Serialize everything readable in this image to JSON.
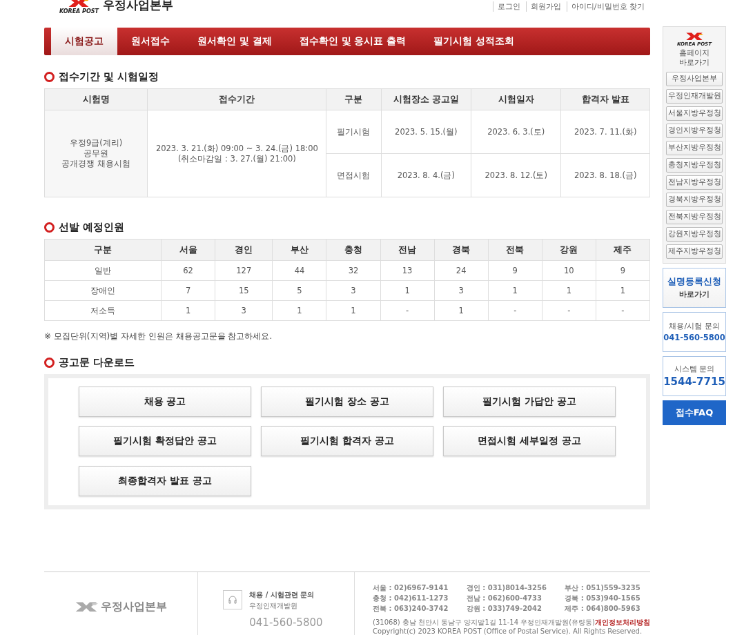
{
  "header": {
    "logo_text": "우정사업본부",
    "logo_caption": "KOREA POST",
    "top_links": [
      "로그인",
      "회원가입",
      "아이디/비밀번호 찾기"
    ]
  },
  "nav": [
    {
      "label": "시험공고",
      "selected": true
    },
    {
      "label": "원서접수",
      "selected": false
    },
    {
      "label": "원서확인 및 결제",
      "selected": false
    },
    {
      "label": "접수확인 및 응시표 출력",
      "selected": false
    },
    {
      "label": "필기시험 성적조회",
      "selected": false
    }
  ],
  "schedule": {
    "title": "접수기간 및 시험일정",
    "columns": [
      "시험명",
      "접수기간",
      "구분",
      "시험장소 공고일",
      "시험일자",
      "합격자 발표"
    ],
    "exam_name": [
      "우정9급(계리)",
      "공무원",
      "공개경쟁 채용시험"
    ],
    "period": [
      "2023. 3. 21.(화) 09:00 ~ 3. 24.(금) 18:00",
      "(취소마감일 : 3. 27.(월) 21:00)"
    ],
    "rows": [
      {
        "type": "필기시험",
        "dates": [
          "2023. 5. 15.(월)",
          "2023. 6. 3.(토)",
          "2023. 7. 11.(화)"
        ]
      },
      {
        "type": "면접시험",
        "dates": [
          "2023. 8. 4.(금)",
          "2023. 8. 12.(토)",
          "2023. 8. 18.(금)"
        ]
      }
    ]
  },
  "quota": {
    "title": "선발 예정인원",
    "columns": [
      "구분",
      "서울",
      "경인",
      "부산",
      "충청",
      "전남",
      "경북",
      "전북",
      "강원",
      "제주"
    ],
    "rows": [
      {
        "label": "일반",
        "values": [
          "62",
          "127",
          "44",
          "32",
          "13",
          "24",
          "9",
          "10",
          "9"
        ]
      },
      {
        "label": "장애인",
        "values": [
          "7",
          "15",
          "5",
          "3",
          "1",
          "3",
          "1",
          "1",
          "1"
        ]
      },
      {
        "label": "저소득",
        "values": [
          "1",
          "3",
          "1",
          "1",
          "-",
          "1",
          "-",
          "-",
          "-"
        ]
      }
    ],
    "note": "※ 모집단위(지역)별 자세한 인원은 채용공고문을 참고하세요."
  },
  "downloads": {
    "title": "공고문 다운로드",
    "buttons": [
      "채용 공고",
      "필기시험 장소 공고",
      "필기시험 가답안 공고",
      "필기시험 확정답안 공고",
      "필기시험 합격자 공고",
      "면접시험 세부일정 공고",
      "최종합격자 발표 공고"
    ]
  },
  "sidebar": {
    "logo_caption": "KOREA POST",
    "homepage_label": [
      "홈페이지",
      "바로가기"
    ],
    "links": [
      "우정사업본부",
      "우정인재개발원",
      "서울지방우정청",
      "경인지방우정청",
      "부산지방우정청",
      "충청지방우정청",
      "전남지방우정청",
      "경북지방우정청",
      "전북지방우정청",
      "강원지방우정청",
      "제주지방우정청"
    ],
    "realname": {
      "title": "실명등록신청",
      "sub": "바로가기"
    },
    "contacts": [
      {
        "label": "채용/시험 문의",
        "number": "041-560-5800"
      },
      {
        "label": "시스템 문의",
        "number": "1544-7715"
      }
    ],
    "faq": "접수FAQ"
  },
  "footer": {
    "logo_text": "우정사업본부",
    "inquiry": {
      "title": "채용 / 시험관련 문의",
      "org": "우정인재개발원",
      "phone": "041-560-5800"
    },
    "phones": [
      "서울 : 02)6967-9141",
      "경인 : 031)8014-3256",
      "부산 : 051)559-3235",
      "충청 : 042)611-1273",
      "전남 : 062)600-4733",
      "경북 : 053)940-1565",
      "전북 : 063)240-3742",
      "강원 : 033)749-2042",
      "제주 : 064)800-5963"
    ],
    "address": "(31068) 충남 천안시 동남구 양지말1길 11-14 우정인재개발원(유량동)",
    "privacy_link": "개인정보처리방침",
    "copyright": "Copyright(c) 2023 KOREA POST (Office of Postal Service). All Rights Reserved."
  }
}
